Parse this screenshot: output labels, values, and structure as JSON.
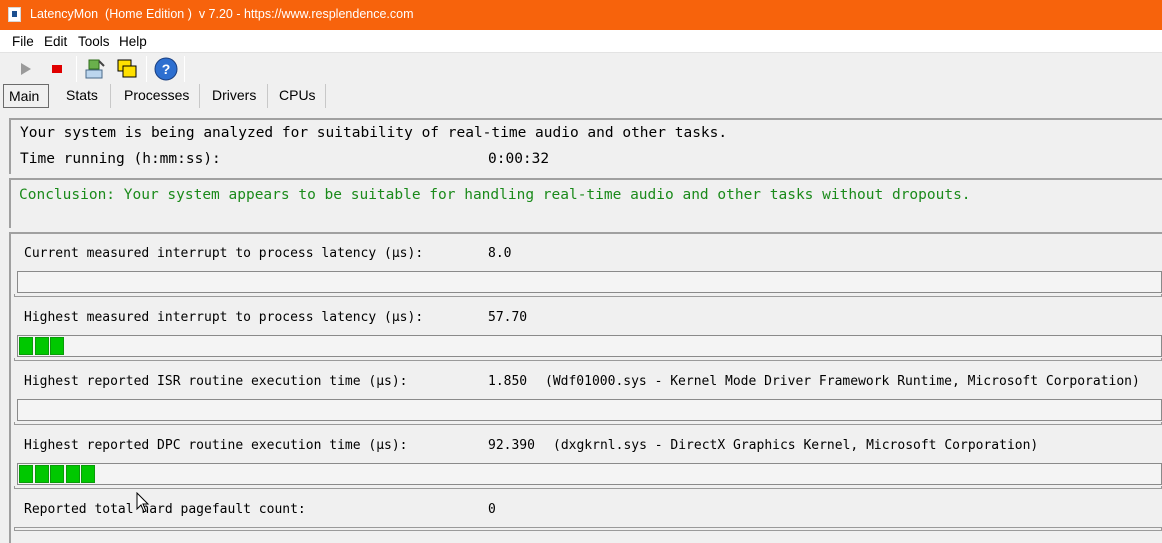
{
  "window": {
    "title": "LatencyMon  (Home Edition )  v 7.20 - https://www.resplendence.com"
  },
  "menu": {
    "items": [
      "File",
      "Edit",
      "Tools",
      "Help"
    ]
  },
  "toolbar": {
    "buttons": [
      "play-icon",
      "stop-icon",
      "computer-icon",
      "windows-icon",
      "help-icon"
    ]
  },
  "tabs": [
    "Main",
    "Stats",
    "Processes",
    "Drivers",
    "CPUs"
  ],
  "status": {
    "analyzing": "Your system is being analyzed for suitability of real-time audio and other tasks.",
    "time_label": "Time running (h:mm:ss):",
    "time_value": "0:00:32"
  },
  "conclusion": "Conclusion: Your system appears to be suitable for handling real-time audio and other tasks without dropouts.",
  "metrics": [
    {
      "label": "Current measured interrupt to process latency (µs):",
      "value": "8.0",
      "detail": "",
      "bar_segments": 0
    },
    {
      "label": "Highest measured interrupt to process latency (µs):",
      "value": "57.70",
      "detail": "",
      "bar_segments": 3
    },
    {
      "label": "Highest reported ISR routine execution time (µs):",
      "value": "1.850",
      "detail": "(Wdf01000.sys - Kernel Mode Driver Framework Runtime, Microsoft Corporation)",
      "bar_segments": 0
    },
    {
      "label": "Highest reported DPC routine execution time (µs):",
      "value": "92.390",
      "detail": "(dxgkrnl.sys - DirectX Graphics Kernel, Microsoft Corporation)",
      "bar_segments": 5
    },
    {
      "label": "Reported total hard pagefault count:",
      "value": "0",
      "detail": ""
    }
  ],
  "colors": {
    "titlebar": "#f7630c",
    "conclusion_text": "#1a8a1a",
    "bar_fill": "#00c800"
  }
}
